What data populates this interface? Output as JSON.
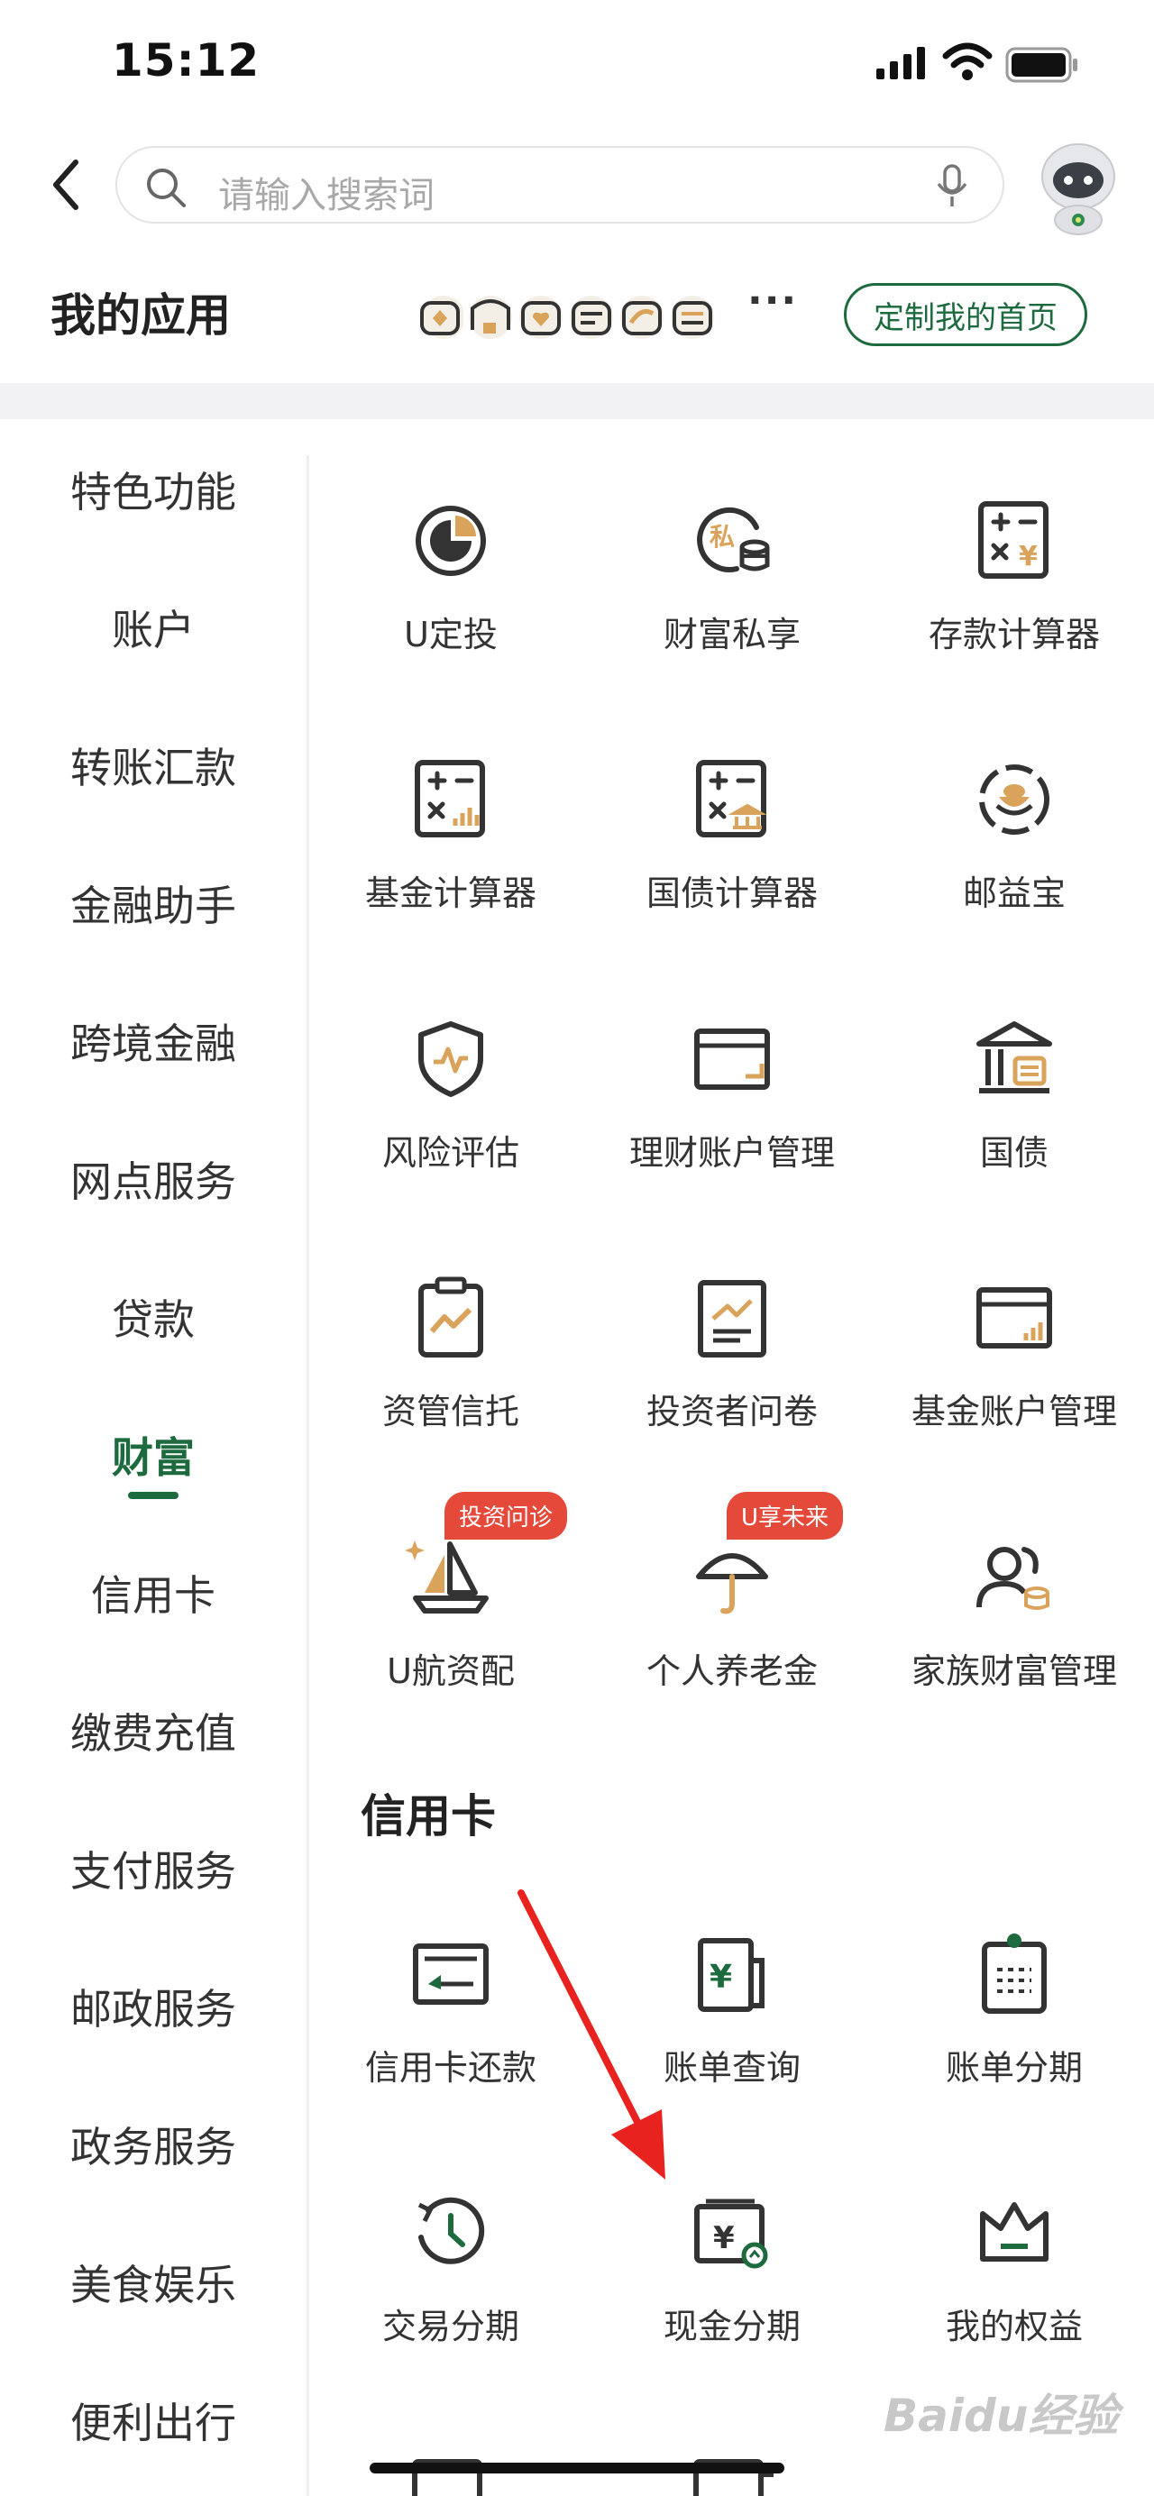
{
  "status_bar": {
    "time": "15:12"
  },
  "search": {
    "placeholder": "请输入搜索词"
  },
  "header": {
    "title": "我的应用",
    "more": "···",
    "customize_label": "定制我的首页"
  },
  "sidebar": {
    "items": [
      "特色功能",
      "账户",
      "转账汇款",
      "金融助手",
      "跨境金融",
      "网点服务",
      "贷款",
      "财富",
      "信用卡",
      "缴费充值",
      "支付服务",
      "邮政服务",
      "政务服务",
      "美食娱乐",
      "便利出行"
    ],
    "active": "财富"
  },
  "wealth": {
    "items": [
      {
        "label": "U定投",
        "icon": "u-fixed-invest-icon"
      },
      {
        "label": "财富私享",
        "icon": "private-wealth-icon"
      },
      {
        "label": "存款计算器",
        "icon": "deposit-calculator-icon"
      },
      {
        "label": "基金计算器",
        "icon": "fund-calculator-icon"
      },
      {
        "label": "国债计算器",
        "icon": "bond-calculator-icon"
      },
      {
        "label": "邮益宝",
        "icon": "youyibao-icon"
      },
      {
        "label": "风险评估",
        "icon": "risk-shield-icon"
      },
      {
        "label": "理财账户管理",
        "icon": "wealth-account-icon"
      },
      {
        "label": "国债",
        "icon": "treasury-bond-icon"
      },
      {
        "label": "资管信托",
        "icon": "asset-trust-icon"
      },
      {
        "label": "投资者问卷",
        "icon": "questionnaire-icon"
      },
      {
        "label": "基金账户管理",
        "icon": "fund-account-icon"
      },
      {
        "label": "U航资配",
        "icon": "sailboat-icon",
        "badge": "投资问诊"
      },
      {
        "label": "个人养老金",
        "icon": "umbrella-icon",
        "badge": "U享未来"
      },
      {
        "label": "家族财富管理",
        "icon": "family-wealth-icon"
      }
    ]
  },
  "credit_card": {
    "title": "信用卡",
    "items": [
      {
        "label": "信用卡还款",
        "icon": "card-repay-icon"
      },
      {
        "label": "账单查询",
        "icon": "bill-query-icon"
      },
      {
        "label": "账单分期",
        "icon": "bill-installment-icon"
      },
      {
        "label": "交易分期",
        "icon": "transaction-installment-icon"
      },
      {
        "label": "现金分期",
        "icon": "cash-installment-icon"
      },
      {
        "label": "我的权益",
        "icon": "crown-icon"
      }
    ]
  },
  "watermark": "Baidu经验",
  "colors": {
    "brand": "#1d6a3e",
    "accent": "#d9a35b",
    "badge": "#e5493a",
    "icon_dark": "#333333"
  }
}
